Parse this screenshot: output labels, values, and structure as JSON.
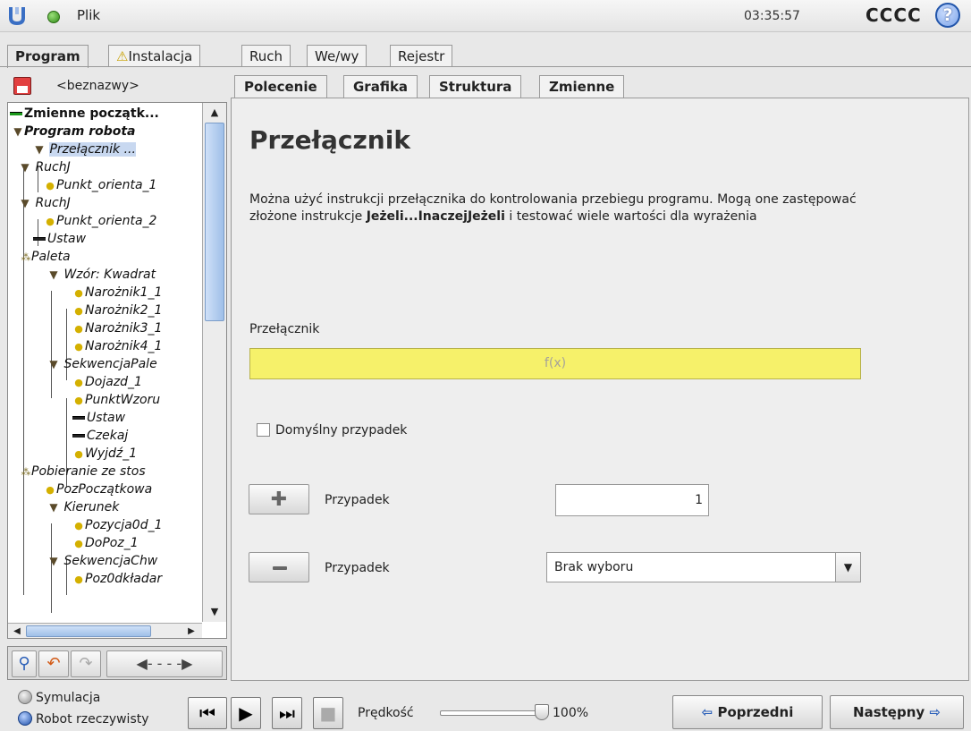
{
  "app": {
    "file_label": "Plik",
    "clock": "03:35:57",
    "robot_name": "CCCC",
    "help_symbol": "?",
    "status_color": "#3b9a1e"
  },
  "main_tabs": [
    {
      "label": "Program",
      "active": true
    },
    {
      "label": "Instalacja",
      "warning_icon": "⚠"
    },
    {
      "label": "Ruch"
    },
    {
      "label": "We/wy"
    },
    {
      "label": "Rejestr"
    }
  ],
  "program": {
    "name": "<beznazwy>"
  },
  "tree": [
    {
      "label": "Zmienne początk...",
      "icon": "variables-icon",
      "bold": true
    },
    {
      "label": "Program robota",
      "icon": "triangle-icon",
      "bold": true
    },
    {
      "label": "Przełącznik ...",
      "icon": "triangle-icon",
      "selected": true
    },
    {
      "label": "RuchJ",
      "icon": "triangle-icon"
    },
    {
      "label": "Punkt_orienta_1",
      "icon": "waypoint-icon"
    },
    {
      "label": "RuchJ",
      "icon": "triangle-icon"
    },
    {
      "label": "Punkt_orienta_2",
      "icon": "waypoint-icon"
    },
    {
      "label": "Ustaw",
      "icon": "set-icon"
    },
    {
      "label": "Paleta",
      "icon": "pallet-icon"
    },
    {
      "label": "Wzór: Kwadrat",
      "icon": "triangle-icon"
    },
    {
      "label": "Narożnik1_1",
      "icon": "waypoint-icon"
    },
    {
      "label": "Narożnik2_1",
      "icon": "waypoint-icon"
    },
    {
      "label": "Narożnik3_1",
      "icon": "waypoint-icon"
    },
    {
      "label": "Narożnik4_1",
      "icon": "waypoint-icon"
    },
    {
      "label": "SekwencjaPale",
      "icon": "triangle-icon"
    },
    {
      "label": "Dojazd_1",
      "icon": "waypoint-icon"
    },
    {
      "label": "PunktWzoru",
      "icon": "waypoint-icon"
    },
    {
      "label": "Ustaw",
      "icon": "set-icon"
    },
    {
      "label": "Czekaj",
      "icon": "set-icon"
    },
    {
      "label": "Wyjdź_1",
      "icon": "waypoint-icon"
    },
    {
      "label": "Pobieranie ze stos",
      "icon": "pallet-icon"
    },
    {
      "label": "PozPoczątkowa",
      "icon": "waypoint-icon"
    },
    {
      "label": "Kierunek",
      "icon": "triangle-icon"
    },
    {
      "label": "Pozycja0d_1",
      "icon": "waypoint-icon"
    },
    {
      "label": "DoPoz_1",
      "icon": "waypoint-icon"
    },
    {
      "label": "SekwencjaChw",
      "icon": "triangle-icon"
    },
    {
      "label": "Poz0dkładar",
      "icon": "waypoint-icon"
    }
  ],
  "sub_tabs": [
    {
      "label": "Polecenie",
      "active": true
    },
    {
      "label": "Grafika"
    },
    {
      "label": "Struktura"
    },
    {
      "label": "Zmienne"
    }
  ],
  "content": {
    "title": "Przełącznik",
    "desc_part1": "Można użyć instrukcji przełącznika do kontrolowania przebiegu programu. Mogą one zastępować złożone instrukcje ",
    "desc_bold": "Jeżeli...InaczejJeżeli",
    "desc_part2": " i testować wiele wartości dla wyrażenia",
    "switch_label": "Przełącznik",
    "expression_placeholder": "f(x)",
    "default_case_label": "Domyślny przypadek",
    "default_case_checked": false,
    "case_label": "Przypadek",
    "case_value": "1",
    "case_select_value": "Brak wyboru",
    "expression_color": "#f6f16a"
  },
  "bottom": {
    "simulation_label": "Symulacja",
    "real_robot_label": "Robot rzeczywisty",
    "speed_label": "Prędkość",
    "speed_value": "100%",
    "speed_fraction": 1.0,
    "prev_label": "Poprzedni",
    "next_label": "Następny"
  }
}
